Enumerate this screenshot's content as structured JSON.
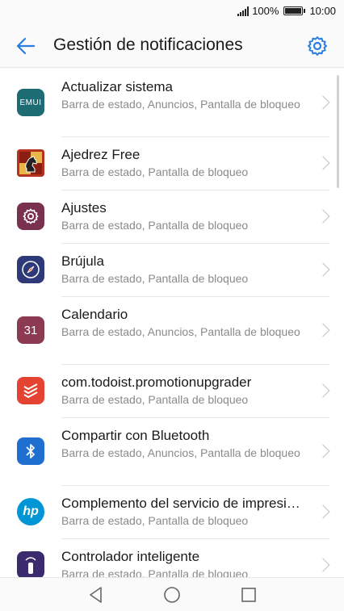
{
  "status": {
    "battery_pct": "100%",
    "time": "10:00"
  },
  "header": {
    "title": "Gestión de notificaciones"
  },
  "apps": [
    {
      "name": "Actualizar sistema",
      "sub": "Barra de estado, Anuncios, Pantalla de bloqueo",
      "icon": "emui-update-icon"
    },
    {
      "name": "Ajedrez Free",
      "sub": "Barra de estado, Pantalla de bloqueo",
      "icon": "chess-icon"
    },
    {
      "name": "Ajustes",
      "sub": "Barra de estado, Pantalla de bloqueo",
      "icon": "settings-gear-icon"
    },
    {
      "name": "Brújula",
      "sub": "Barra de estado, Pantalla de bloqueo",
      "icon": "compass-icon"
    },
    {
      "name": "Calendario",
      "sub": "Barra de estado, Anuncios, Pantalla de bloqueo",
      "icon": "calendar-icon",
      "icon_text": "31"
    },
    {
      "name": "com.todoist.promotionupgrader",
      "sub": "Barra de estado, Pantalla de bloqueo",
      "icon": "todoist-icon"
    },
    {
      "name": "Compartir con Bluetooth",
      "sub": "Barra de estado, Anuncios, Pantalla de bloqueo",
      "icon": "bluetooth-icon"
    },
    {
      "name": "Complemento del servicio de impresi…",
      "sub": "Barra de estado, Pantalla de bloqueo",
      "icon": "hp-icon",
      "icon_text": "hp"
    },
    {
      "name": "Controlador inteligente",
      "sub": "Barra de estado, Pantalla de bloqueo",
      "icon": "remote-control-icon"
    }
  ],
  "emui_label": "EMUI",
  "colors": {
    "accent": "#2a7de1",
    "calendar": "#8b3a52",
    "todoist": "#e44332",
    "bluetooth": "#1f6fd1",
    "hp": "#0096d6"
  }
}
